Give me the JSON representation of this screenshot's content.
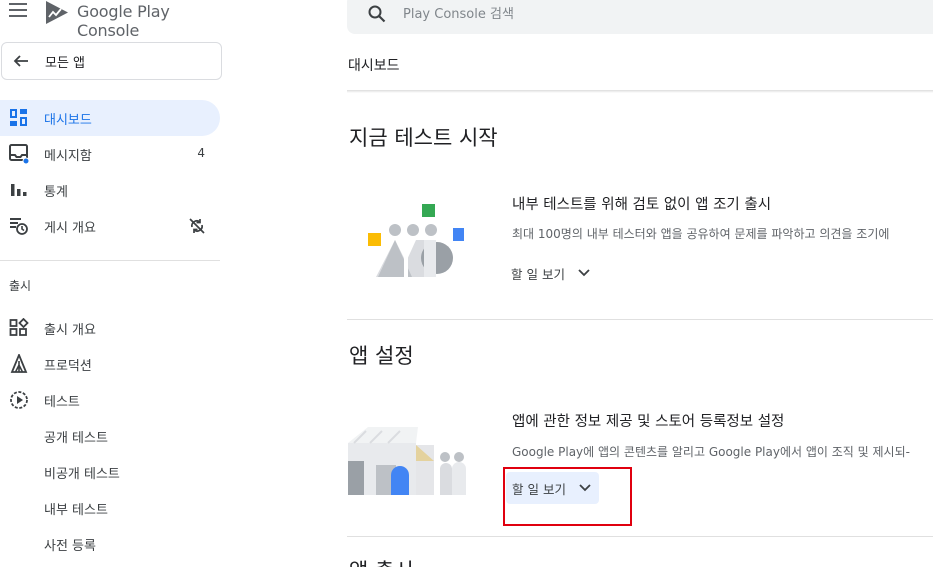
{
  "header": {
    "logo_text": "Google Play Console"
  },
  "sidebar": {
    "all_apps_label": "모든 앱",
    "items": [
      {
        "label": "대시보드",
        "icon": "dashboard-icon"
      },
      {
        "label": "메시지함",
        "icon": "inbox-icon",
        "count": "4"
      },
      {
        "label": "통계",
        "icon": "bar-chart-icon"
      },
      {
        "label": "게시 개요",
        "icon": "publishing-icon",
        "trailing_icon": "sync-disabled-icon"
      }
    ],
    "section_label": "출시",
    "release_items": [
      {
        "label": "출시 개요",
        "icon": "release-overview-icon"
      },
      {
        "label": "프로덕션",
        "icon": "production-icon"
      },
      {
        "label": "테스트",
        "icon": "testing-icon"
      }
    ],
    "test_subitems": [
      {
        "label": "공개 테스트"
      },
      {
        "label": "비공개 테스트"
      },
      {
        "label": "내부 테스트"
      },
      {
        "label": "사전 등록"
      }
    ]
  },
  "search": {
    "placeholder": "Play Console 검색"
  },
  "breadcrumb": "대시보드",
  "sections": [
    {
      "title": "지금 테스트 시작",
      "card": {
        "title": "내부 테스트를 위해 검토 없이 앱 조기 출시",
        "description": "최대 100명의 내부 테스터와 앱을 공유하여 문제를 파악하고 의견을 조기에",
        "todo_label": "할 일 보기"
      }
    },
    {
      "title": "앱 설정",
      "card": {
        "title": "앱에 관한 정보 제공 및 스토어 등록정보 설정",
        "description": "Google Play에 앱의 콘텐츠를 알리고 Google Play에서 앱이 조직 및 제시되-",
        "todo_label": "할 일 보기"
      }
    },
    {
      "title": "앱 출시"
    }
  ],
  "colors": {
    "accent": "#1a73e8",
    "active_bg": "#e8f0fe",
    "highlight_box": "#e0000f"
  }
}
